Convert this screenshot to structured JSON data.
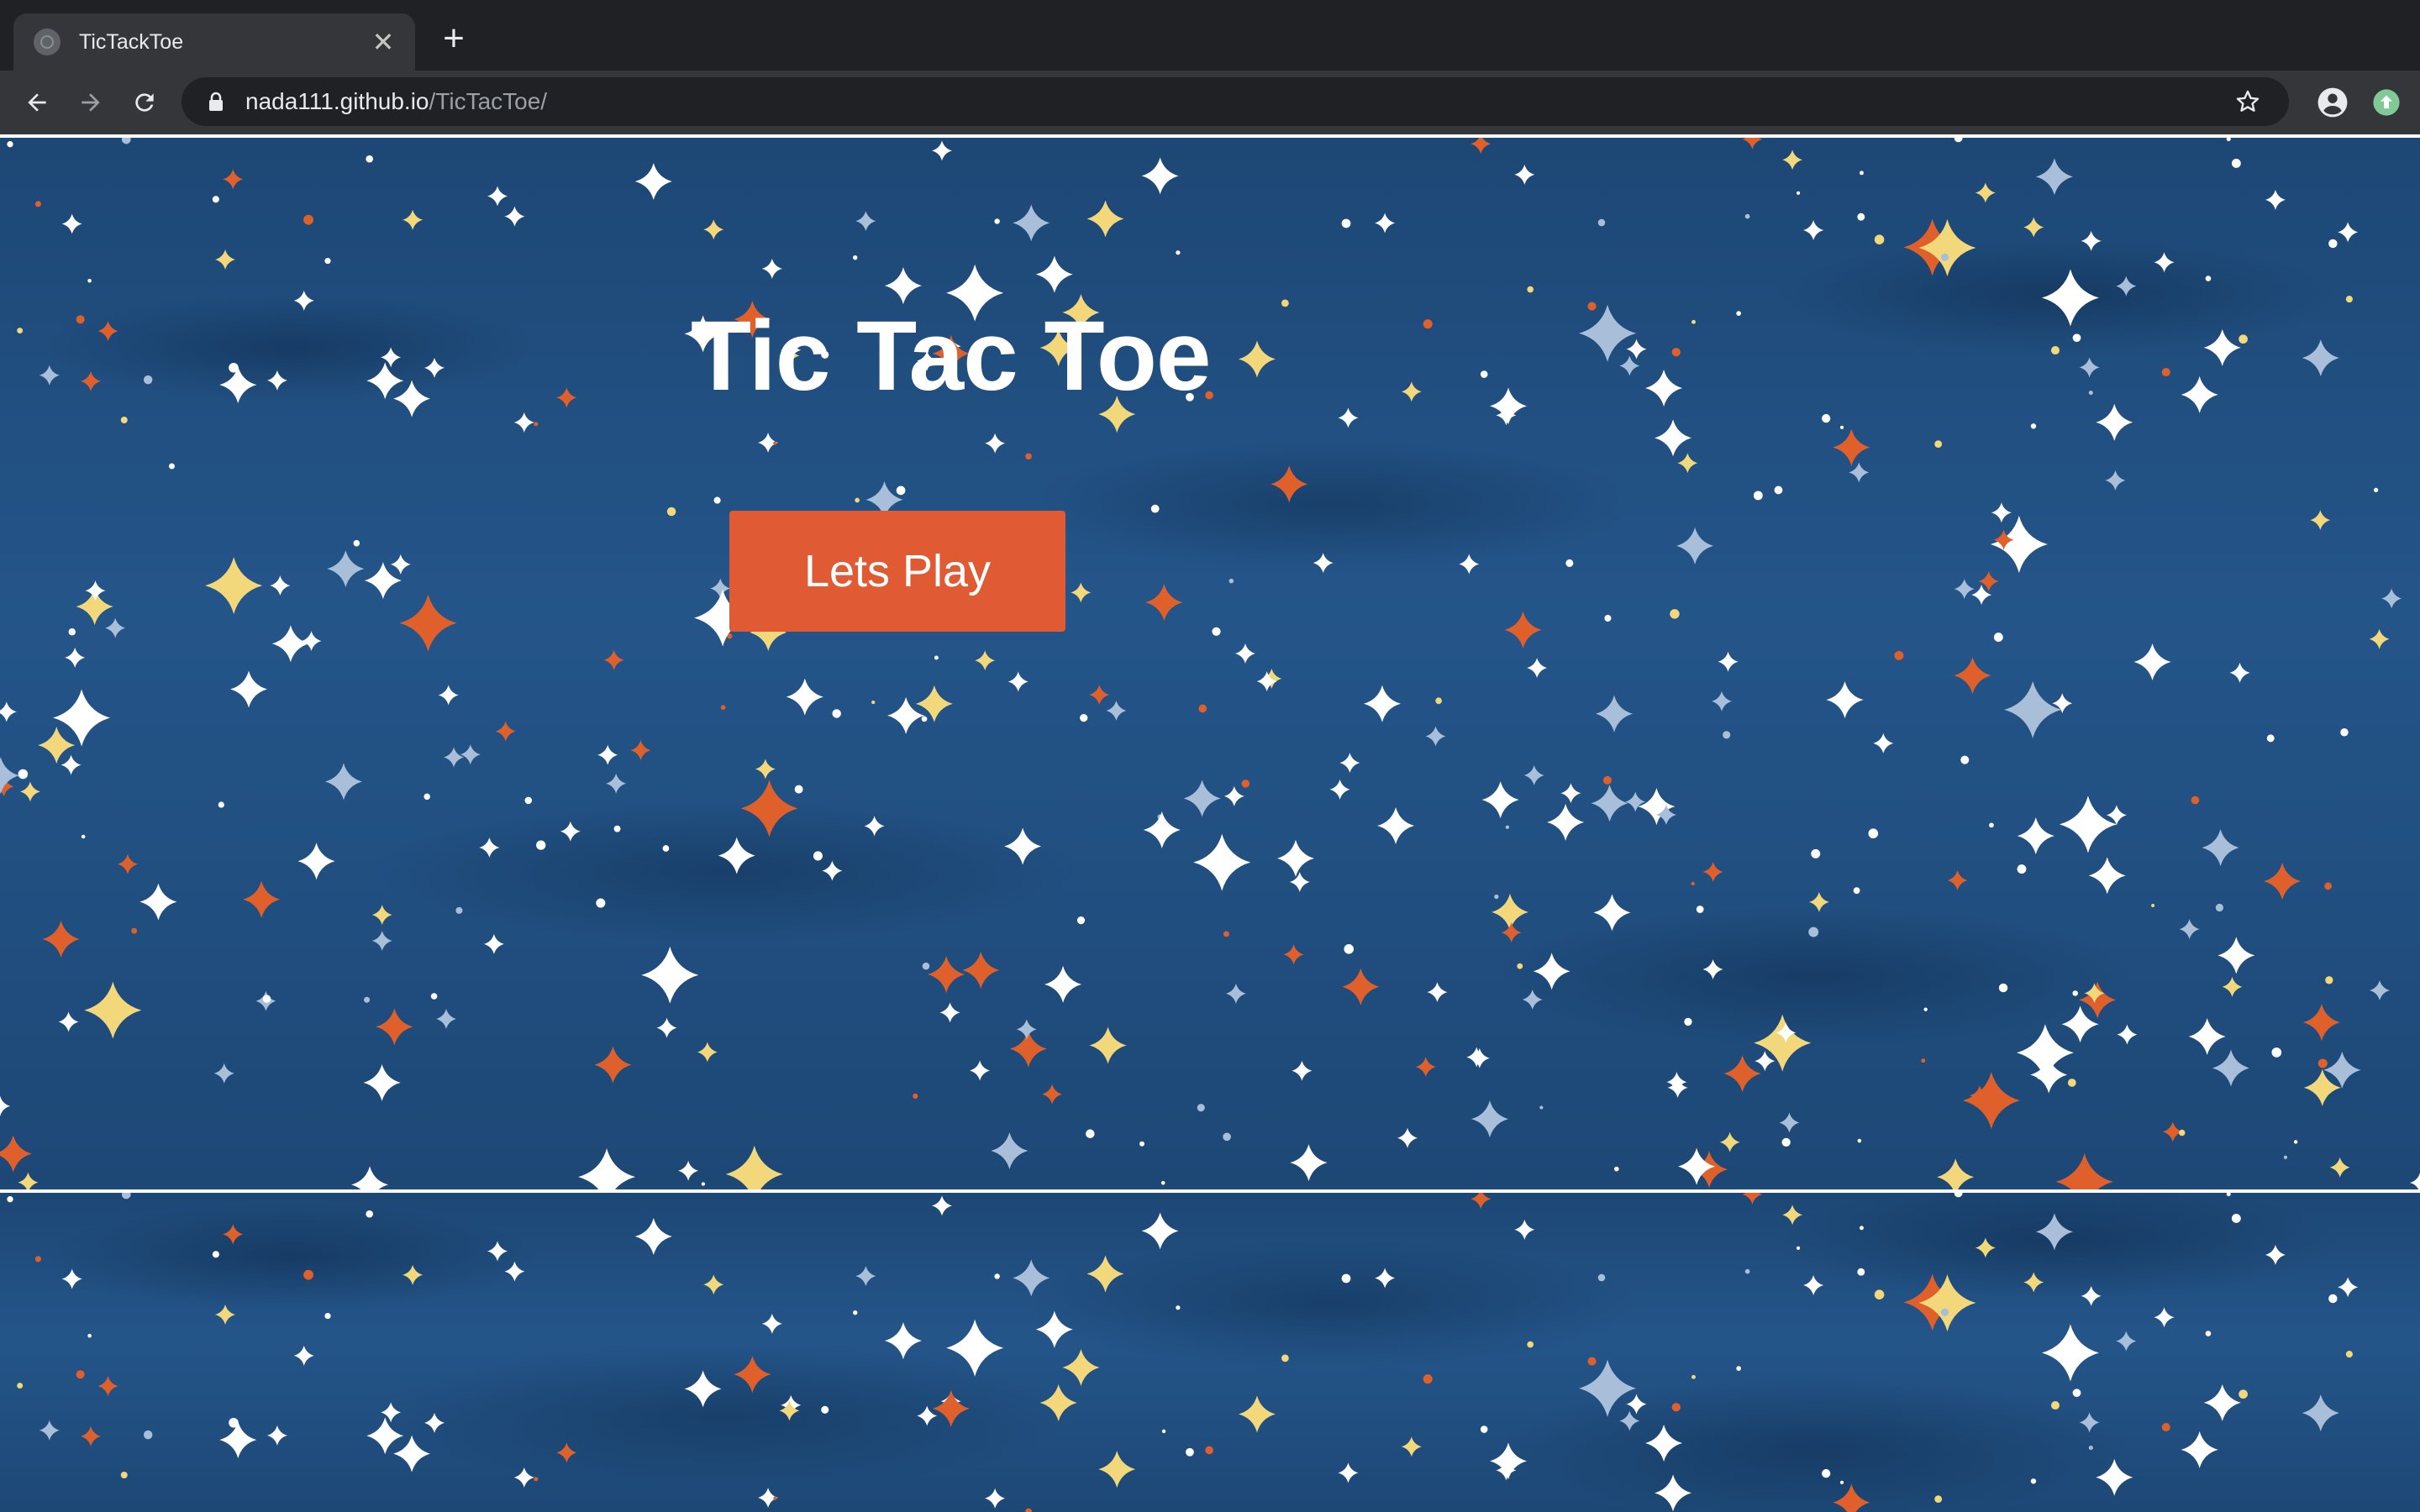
{
  "browser": {
    "tab": {
      "title": "TicTackToe",
      "close_icon": "close-icon"
    },
    "new_tab_icon": "plus-icon",
    "address_bar": {
      "host": "nada111.github.io",
      "path": "/TicTacToe/"
    },
    "icons": {
      "back": "arrow-left-icon",
      "forward": "arrow-right-icon",
      "reload": "reload-icon",
      "lock": "lock-icon",
      "bookmark": "star-icon",
      "profile": "account-circle-icon",
      "update": "update-arrow-icon"
    }
  },
  "page": {
    "title": "Tic Tac Toe",
    "play_button_label": "Lets Play"
  },
  "colors": {
    "background_blue": "#1f4a78",
    "button": "#e05a33",
    "divider": "#ffffff",
    "star_white": "#ffffff",
    "star_yellow": "#f2d87a",
    "star_orange": "#e0602c",
    "star_pale_blue": "#a9bfd9"
  }
}
